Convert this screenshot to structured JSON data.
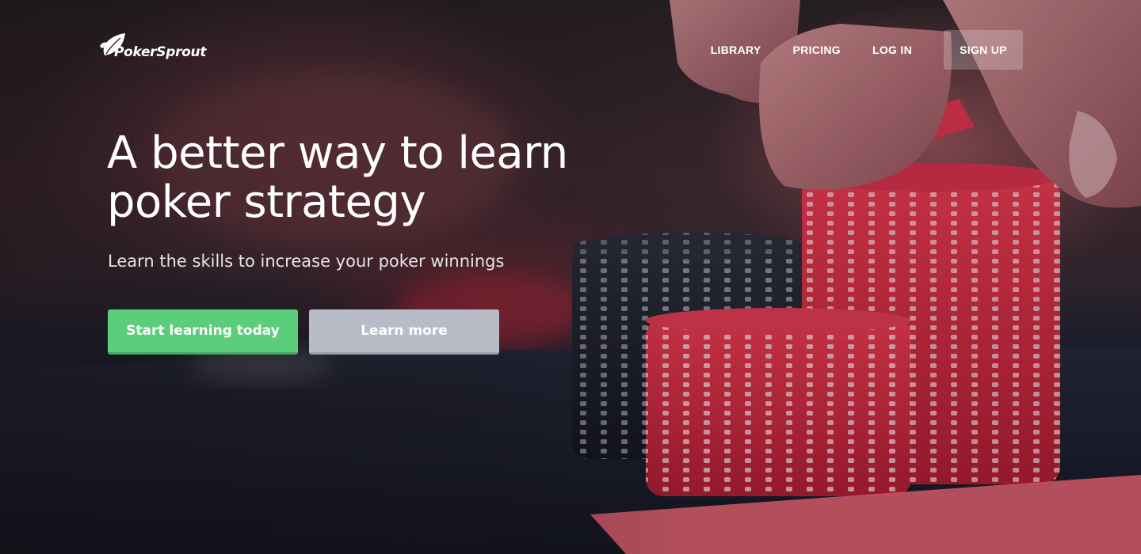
{
  "brand": {
    "name": "PokerSprout",
    "logo_icon": "leaf-icon"
  },
  "nav": {
    "library": "LIBRARY",
    "pricing": "PRICING",
    "login": "LOG IN",
    "signup": "SIGN UP"
  },
  "hero": {
    "headline_line1": "A better way to learn",
    "headline_line2": "poker strategy",
    "subheadline": "Learn the skills to increase your poker winnings",
    "primary_cta": "Start learning today",
    "secondary_cta": "Learn more"
  },
  "colors": {
    "primary_button": "#5ccd7b",
    "secondary_button": "#b7bcc6",
    "signup_button": "rgba(255,255,255,0.22)",
    "chip_red": "#c4283c",
    "chip_black": "#1c1e28"
  }
}
